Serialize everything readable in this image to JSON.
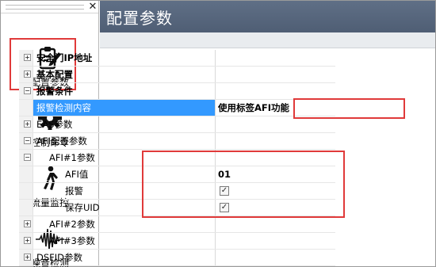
{
  "sidebar": {
    "items": [
      {
        "label": "配置参数",
        "icon": "clipboard-edit-icon"
      },
      {
        "label": "控制命令",
        "icon": "gear-icon"
      },
      {
        "label": "流量监控",
        "icon": "walking-person-icon"
      },
      {
        "label": "噪音检测",
        "icon": "waveform-icon"
      }
    ]
  },
  "main": {
    "title": "配置参数",
    "rows": [
      {
        "name": "安全门IP地址",
        "expander": "+"
      },
      {
        "name": "基本配置",
        "expander": "+"
      },
      {
        "name": "报警条件",
        "expander": "−"
      },
      {
        "name": "报警检测内容",
        "value": "使用标签AFI功能"
      },
      {
        "name": "EAS参数",
        "expander": "+"
      },
      {
        "name": "AFI配置参数",
        "expander": "−"
      },
      {
        "name": "AFI#1参数",
        "expander": "−"
      },
      {
        "name": "AFI值",
        "value": "01"
      },
      {
        "name": "报警",
        "checked": "✓"
      },
      {
        "name": "保存UID",
        "checked": "✓"
      },
      {
        "name": "AFI#2参数",
        "expander": "+"
      },
      {
        "name": "AFI#3参数",
        "expander": "+"
      },
      {
        "name": "DSFID参数",
        "expander": "+"
      }
    ]
  },
  "colors": {
    "titlebar": "#56667c",
    "selection": "#3399ff",
    "highlight_box": "#e03a3a"
  }
}
